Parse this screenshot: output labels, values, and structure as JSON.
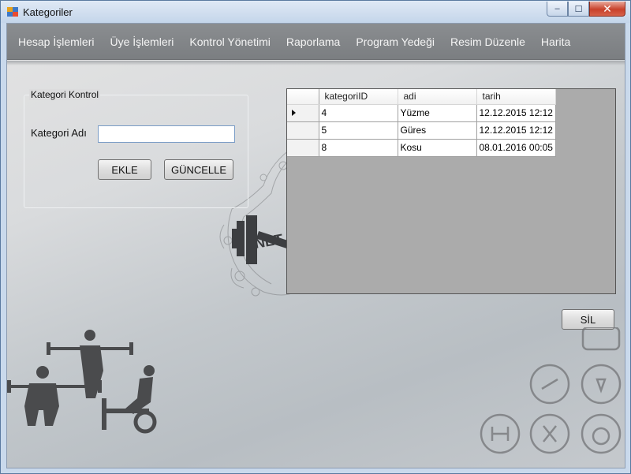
{
  "window": {
    "title": "Kategoriler",
    "minimize_label": "–",
    "maximize_label": "☐",
    "close_label": "✕"
  },
  "menu": {
    "items": [
      "Hesap İşlemleri",
      "Üye İşlemleri",
      "Kontrol Yönetimi",
      "Raporlama",
      "Program Yedeği",
      "Resim Düzenle",
      "Harita"
    ]
  },
  "form": {
    "group_title": "Kategori Kontrol",
    "name_label": "Kategori Adı",
    "name_value": "",
    "add_button": "EKLE",
    "update_button": "GÜNCELLE",
    "delete_button": "SİL"
  },
  "grid": {
    "columns": [
      "kategoriID",
      "adi",
      "tarih"
    ],
    "rows": [
      {
        "kategoriID": "4",
        "adi": "Yüzme",
        "tarih": "12.12.2015 12:12",
        "current": true
      },
      {
        "kategoriID": "5",
        "adi": "Güres",
        "tarih": "12.12.2015 12:12",
        "current": false
      },
      {
        "kategoriID": "8",
        "adi": "Kosu",
        "tarih": "08.01.2016 00:05",
        "current": false
      }
    ]
  },
  "background": {
    "logo_text": "NET"
  }
}
